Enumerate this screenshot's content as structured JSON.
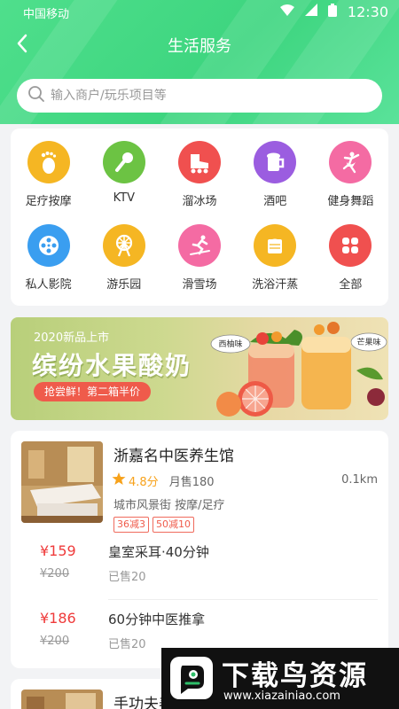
{
  "status_bar": {
    "carrier": "中国移动",
    "time": "12:30"
  },
  "nav": {
    "title": "生活服务"
  },
  "search": {
    "placeholder": "输入商户/玩乐项目等"
  },
  "categories": [
    {
      "label": "足疗按摩",
      "icon": "foot-icon",
      "color": "#f5b623"
    },
    {
      "label": "KTV",
      "icon": "microphone-icon",
      "color": "#6cc343"
    },
    {
      "label": "溜冰场",
      "icon": "roller-skate-icon",
      "color": "#f0504f"
    },
    {
      "label": "酒吧",
      "icon": "beer-icon",
      "color": "#9b5de0"
    },
    {
      "label": "健身舞蹈",
      "icon": "dancer-icon",
      "color": "#f46ba3"
    },
    {
      "label": "私人影院",
      "icon": "film-reel-icon",
      "color": "#3a9ef0"
    },
    {
      "label": "游乐园",
      "icon": "ferris-wheel-icon",
      "color": "#f5b623"
    },
    {
      "label": "滑雪场",
      "icon": "skier-icon",
      "color": "#f46ba3"
    },
    {
      "label": "洗浴汗蒸",
      "icon": "towel-icon",
      "color": "#f5b623"
    },
    {
      "label": "全部",
      "icon": "grid-all-icon",
      "color": "#f0504f"
    }
  ],
  "banner": {
    "subtitle": "2020新品上市",
    "title": "缤纷水果酸奶",
    "tag": "抢尝鲜！第二箱半价",
    "bubble_left": "西柚味",
    "bubble_right": "芒果味"
  },
  "shop": {
    "name": "浙嘉名中医养生馆",
    "rating": "4.8分",
    "monthly_sold": "月售180",
    "distance": "0.1km",
    "location": "城市风景街  按摩/足疗",
    "tags": [
      "36减3",
      "50减10"
    ],
    "deals": [
      {
        "price": "¥159",
        "original": "¥200",
        "name": "皇室采耳·40分钟",
        "sold": "已售20"
      },
      {
        "price": "¥186",
        "original": "¥200",
        "name": "60分钟中医推拿",
        "sold": "已售20"
      }
    ]
  },
  "shop2": {
    "name": "手功夫养生馆"
  },
  "watermark": {
    "title": "下载鸟资源",
    "url": "www.xiazainiao.com"
  },
  "colors": {
    "accent": "#3dd57f",
    "price": "#ef3b3b",
    "star": "#f7a21b"
  }
}
